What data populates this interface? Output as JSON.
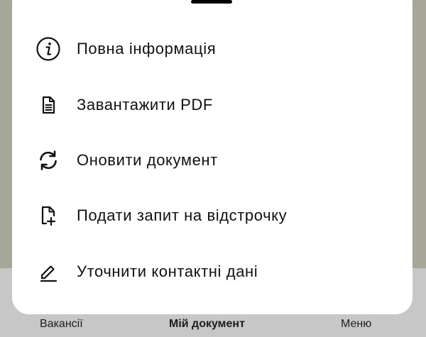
{
  "sheet": {
    "items": [
      {
        "label": "Повна інформація",
        "icon": "info-icon"
      },
      {
        "label": "Завантажити PDF",
        "icon": "document-icon"
      },
      {
        "label": "Оновити документ",
        "icon": "refresh-icon"
      },
      {
        "label": "Подати запит на відстрочку",
        "icon": "file-add-icon"
      },
      {
        "label": "Уточнити контактні дані",
        "icon": "pencil-icon"
      }
    ]
  },
  "bottom_nav": {
    "items": [
      {
        "label": "Вакансії"
      },
      {
        "label": "Мій документ",
        "active": true
      },
      {
        "label": "Меню"
      }
    ]
  }
}
